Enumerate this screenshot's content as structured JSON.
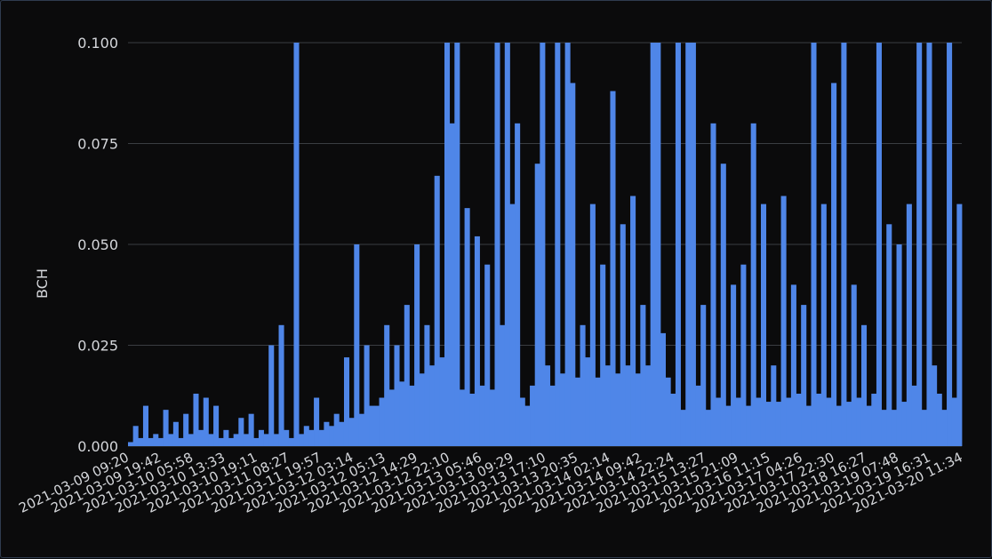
{
  "chart_data": {
    "type": "bar",
    "ylabel": "BCH",
    "ylim": [
      0,
      0.1
    ],
    "yticks": [
      "0.000",
      "0.025",
      "0.050",
      "0.075",
      "0.100"
    ],
    "xlim": [
      "2021-03-09 09:20",
      "2021-03-20 11:34"
    ],
    "xticks": [
      "2021-03-09 09:20",
      "2021-03-09 19:42",
      "2021-03-10 05:58",
      "2021-03-10 13:33",
      "2021-03-10 19:11",
      "2021-03-11 08:27",
      "2021-03-11 19:57",
      "2021-03-12 03:14",
      "2021-03-12 05:13",
      "2021-03-12 14:29",
      "2021-03-12 22:10",
      "2021-03-13 05:46",
      "2021-03-13 09:29",
      "2021-03-13 17:10",
      "2021-03-13 20:35",
      "2021-03-14 02:14",
      "2021-03-14 09:42",
      "2021-03-14 22:24",
      "2021-03-15 13:27",
      "2021-03-15 21:09",
      "2021-03-16 11:15",
      "2021-03-17 04:26",
      "2021-03-17 22:30",
      "2021-03-18 16:27",
      "2021-03-19 07:48",
      "2021-03-19 16:31",
      "2021-03-20 11:34"
    ],
    "values": [
      0.001,
      0.005,
      0.002,
      0.01,
      0.002,
      0.003,
      0.002,
      0.009,
      0.003,
      0.006,
      0.002,
      0.008,
      0.003,
      0.013,
      0.004,
      0.012,
      0.003,
      0.01,
      0.002,
      0.004,
      0.002,
      0.003,
      0.007,
      0.003,
      0.008,
      0.002,
      0.004,
      0.003,
      0.025,
      0.003,
      0.03,
      0.004,
      0.002,
      0.1,
      0.003,
      0.005,
      0.004,
      0.012,
      0.004,
      0.006,
      0.005,
      0.008,
      0.006,
      0.022,
      0.007,
      0.05,
      0.008,
      0.025,
      0.01,
      0.01,
      0.012,
      0.03,
      0.014,
      0.025,
      0.016,
      0.035,
      0.015,
      0.05,
      0.018,
      0.03,
      0.02,
      0.067,
      0.022,
      0.1,
      0.08,
      0.1,
      0.014,
      0.059,
      0.013,
      0.052,
      0.015,
      0.045,
      0.014,
      0.1,
      0.03,
      0.1,
      0.06,
      0.08,
      0.012,
      0.01,
      0.015,
      0.07,
      0.1,
      0.02,
      0.015,
      0.1,
      0.018,
      0.1,
      0.09,
      0.017,
      0.03,
      0.022,
      0.06,
      0.017,
      0.045,
      0.02,
      0.088,
      0.018,
      0.055,
      0.02,
      0.062,
      0.018,
      0.035,
      0.02,
      0.1,
      0.1,
      0.028,
      0.017,
      0.013,
      0.1,
      0.009,
      0.1,
      0.1,
      0.015,
      0.035,
      0.009,
      0.08,
      0.012,
      0.07,
      0.01,
      0.04,
      0.012,
      0.045,
      0.01,
      0.08,
      0.012,
      0.06,
      0.011,
      0.02,
      0.011,
      0.062,
      0.012,
      0.04,
      0.013,
      0.035,
      0.01,
      0.1,
      0.013,
      0.06,
      0.012,
      0.09,
      0.01,
      0.1,
      0.011,
      0.04,
      0.012,
      0.03,
      0.01,
      0.013,
      0.1,
      0.009,
      0.055,
      0.009,
      0.05,
      0.011,
      0.06,
      0.015,
      0.1,
      0.009,
      0.1,
      0.02,
      0.013,
      0.009,
      0.1,
      0.012,
      0.06
    ]
  }
}
